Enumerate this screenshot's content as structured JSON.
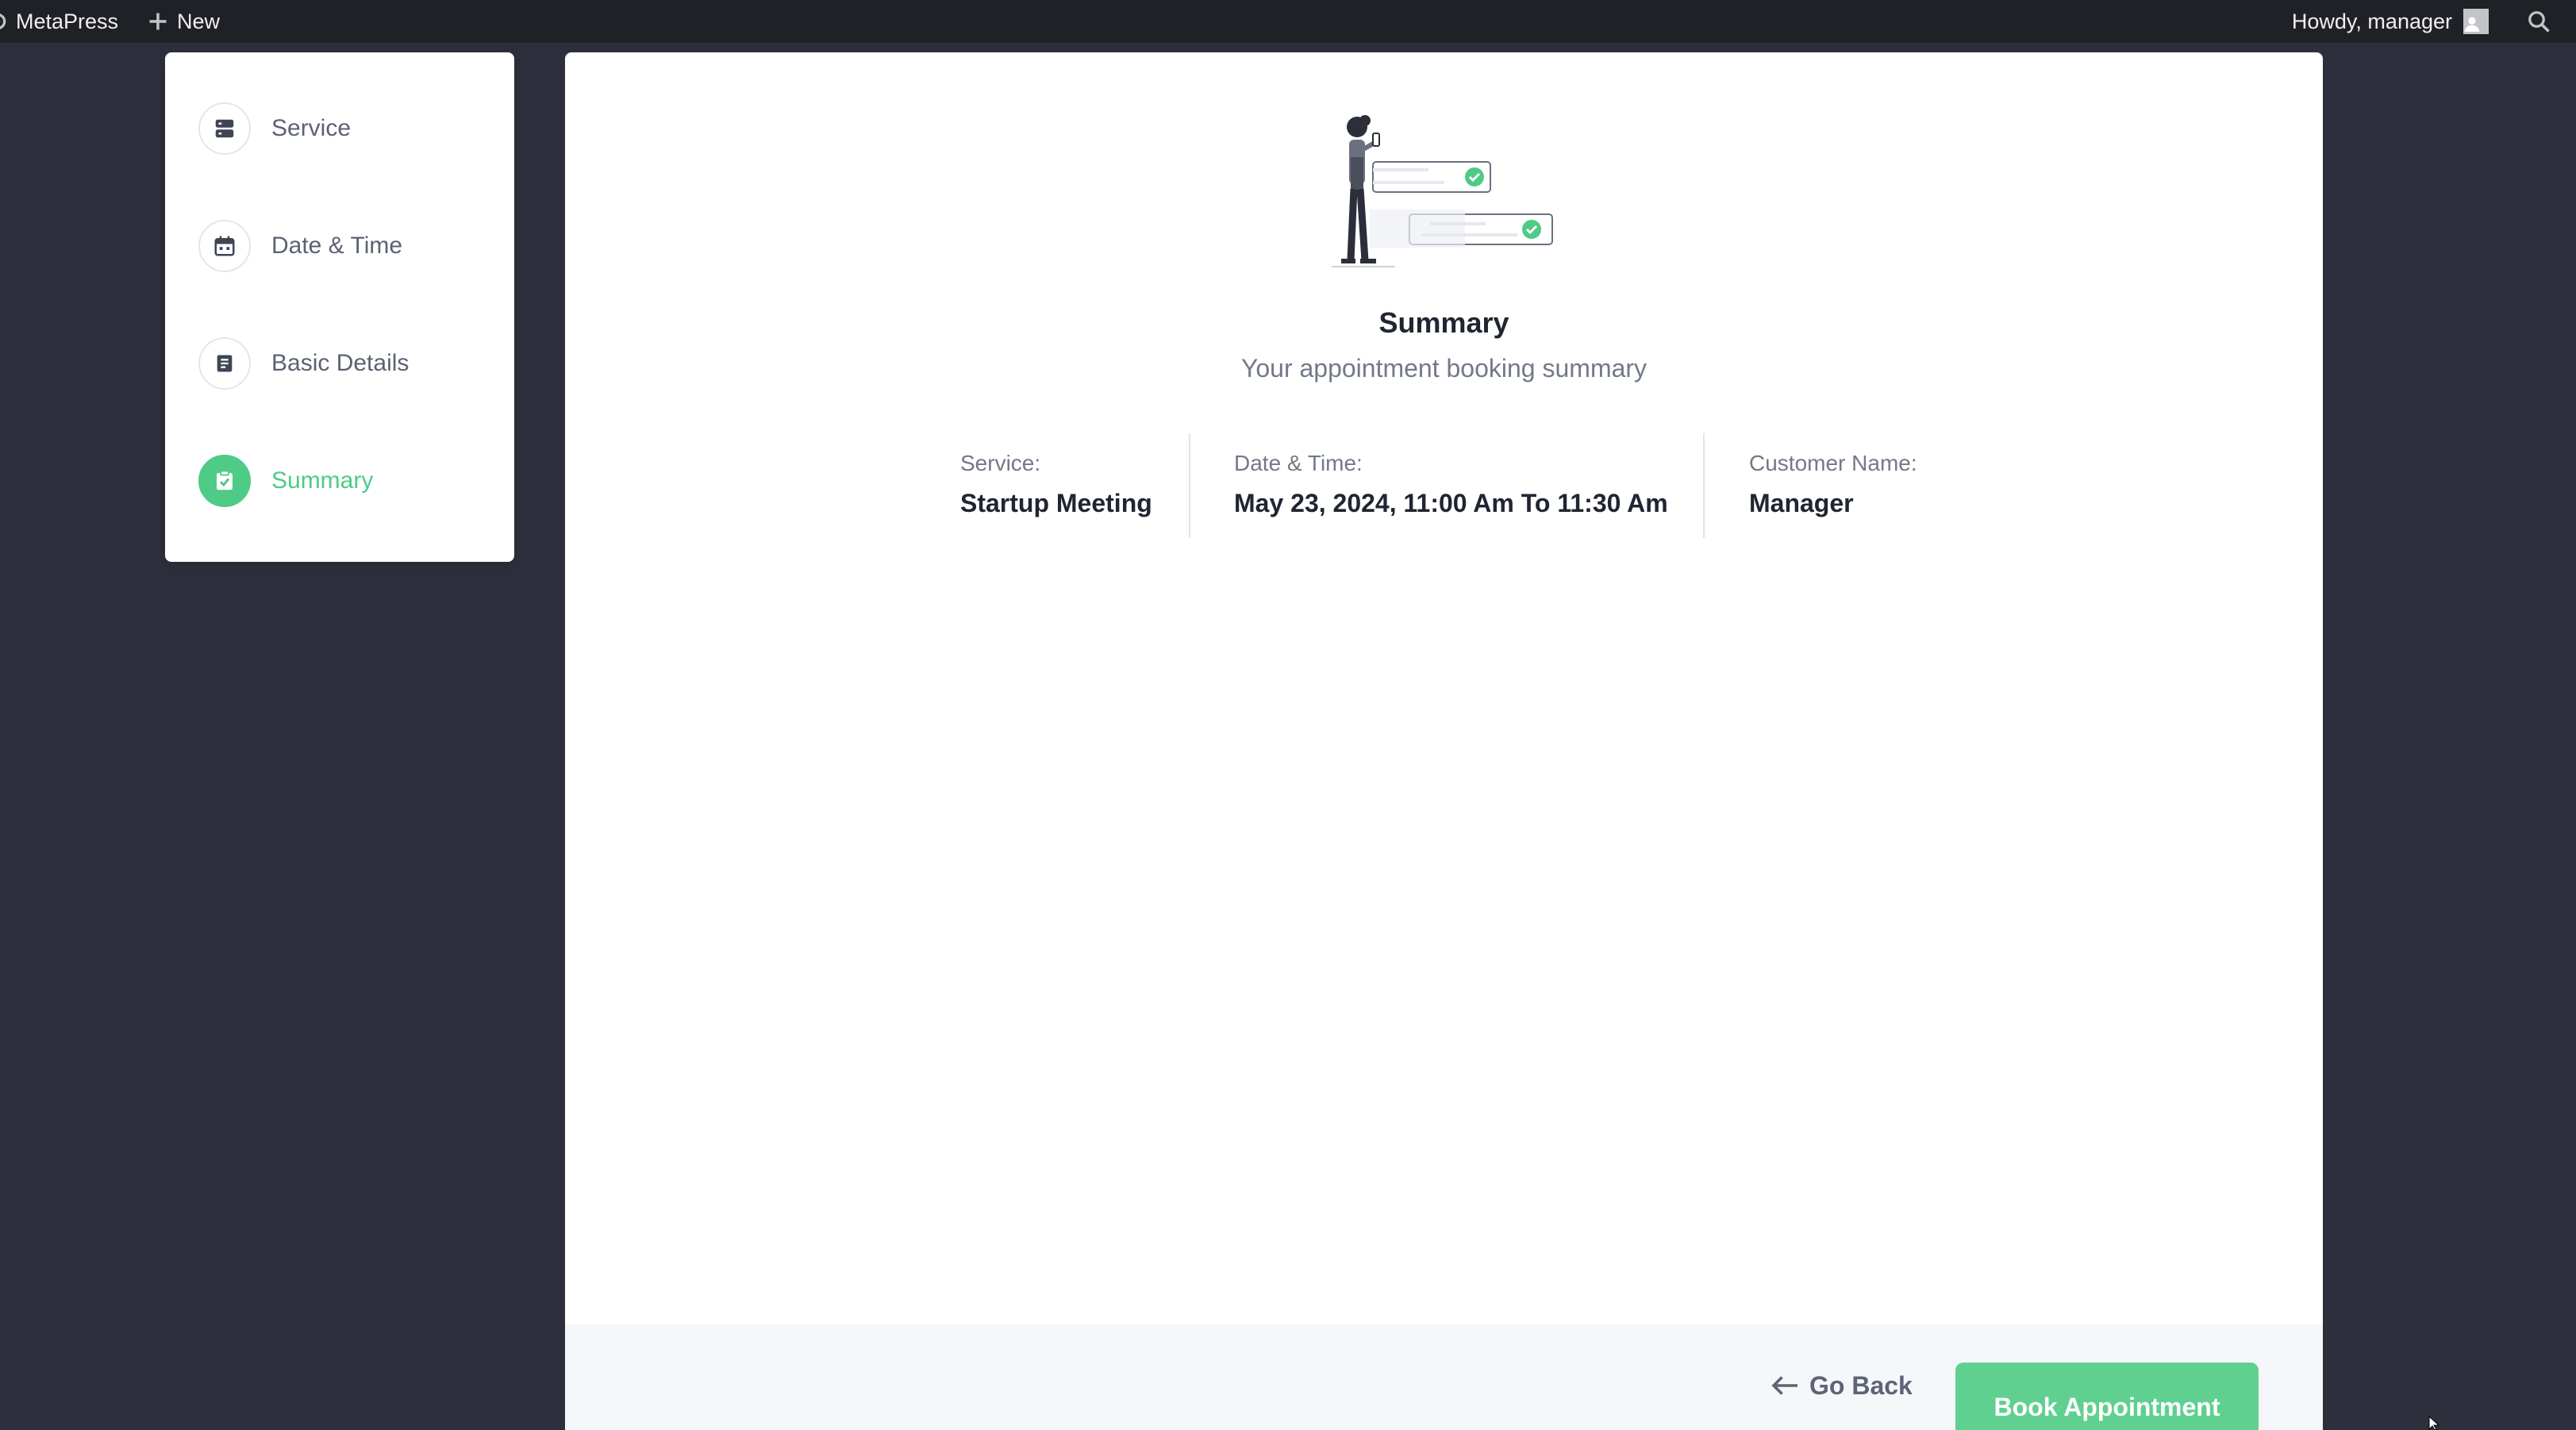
{
  "adminbar": {
    "site_name": "MetaPress",
    "new_label": "New",
    "greeting": "Howdy, manager"
  },
  "steps": [
    {
      "label": "Service",
      "icon": "server-icon",
      "active": false
    },
    {
      "label": "Date & Time",
      "icon": "calendar-icon",
      "active": false
    },
    {
      "label": "Basic Details",
      "icon": "document-icon",
      "active": false
    },
    {
      "label": "Summary",
      "icon": "check-clipboard-icon",
      "active": true
    }
  ],
  "summary": {
    "title": "Summary",
    "subtitle": "Your appointment booking summary",
    "service_label": "Service:",
    "service_value": "Startup Meeting",
    "datetime_label": "Date & Time:",
    "datetime_value": "May 23, 2024, 11:00 Am To 11:30 Am",
    "customer_label": "Customer Name:",
    "customer_value": "Manager"
  },
  "footer": {
    "go_back_label": "Go Back",
    "book_label": "Book Appointment"
  },
  "colors": {
    "accent": "#4ecb86",
    "background": "#2d2f3c",
    "adminbar": "#1f2126"
  }
}
